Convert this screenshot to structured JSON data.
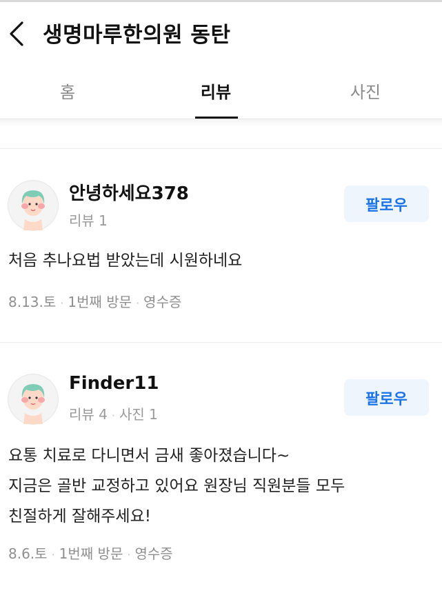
{
  "header": {
    "title": "생명마루한의원 동탄"
  },
  "tabs": [
    {
      "label": "홈",
      "active": false
    },
    {
      "label": "리뷰",
      "active": true
    },
    {
      "label": "사진",
      "active": false
    }
  ],
  "reviews": [
    {
      "author": "안녕하세요378",
      "meta": [
        "리뷰 1"
      ],
      "follow_label": "팔로우",
      "text": [
        "처음 추나요법 받았는데 시원하네요"
      ],
      "footer": [
        "8.13.토",
        "1번째 방문",
        "영수증"
      ]
    },
    {
      "author": "Finder11",
      "meta": [
        "리뷰 4",
        "사진 1"
      ],
      "follow_label": "팔로우",
      "text": [
        "요통 치료로 다니면서 금새 좋아졌습니다~",
        "지금은 골반 교정하고 있어요 원장님 직원분들 모두",
        "친절하게 잘해주세요!"
      ],
      "footer": [
        "8.6.토",
        "1번째 방문",
        "영수증"
      ]
    }
  ],
  "icons": {
    "back": "chevron-left-icon",
    "avatar": "avatar-icon"
  },
  "colors": {
    "accent": "#1a73e8",
    "follow_bg": "#eef5fd",
    "avatar_hair": "#7fcdb5",
    "avatar_skin": "#ffd9c8"
  }
}
